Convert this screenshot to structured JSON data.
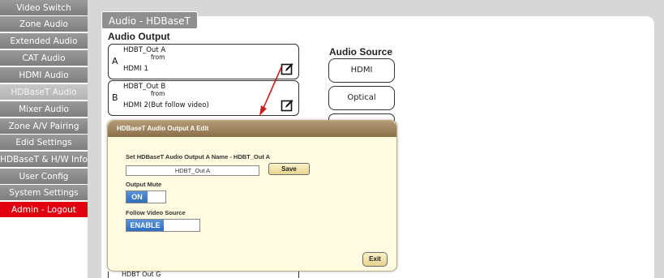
{
  "sidebar": {
    "items": [
      {
        "label": "Video Switch"
      },
      {
        "label": "Zone Audio"
      },
      {
        "label": "Extended Audio"
      },
      {
        "label": "CAT Audio"
      },
      {
        "label": "HDMI Audio"
      },
      {
        "label": "HDBaseT Audio"
      },
      {
        "label": "Mixer Audio"
      },
      {
        "label": "Zone A/V Pairing"
      },
      {
        "label": "Edid Settings"
      },
      {
        "label": "HDBaseT & H/W Info"
      },
      {
        "label": "User Config"
      },
      {
        "label": "System Settings"
      },
      {
        "label": "Admin - Logout"
      }
    ],
    "active_index": 5
  },
  "page": {
    "tab_title": "Audio - HDBaseT",
    "audio_output_title": "Audio Output",
    "audio_source_title": "Audio Source"
  },
  "outputs": [
    {
      "name": "HDBT_Out A",
      "from": "from",
      "letter": "A",
      "source": "HDMI 1"
    },
    {
      "name": "HDBT_Out B",
      "from": "from",
      "letter": "B",
      "source": "HDMI 2(But follow video)"
    }
  ],
  "bottom_partial_output": "HDBT Out G",
  "sources": [
    {
      "label": "HDMI"
    },
    {
      "label": "Optical"
    }
  ],
  "dialog": {
    "title": "HDBaseT Audio Output A Edit",
    "name_label": "Set HDBaseT Audio Output A Name - HDBT_Out A",
    "name_value": "HDBT_Out A",
    "save_label": "Save",
    "mute_label": "Output Mute",
    "mute_state": "ON",
    "follow_label": "Follow Video Source",
    "follow_state": "ENABLE",
    "exit_label": "Exit"
  },
  "colors": {
    "nav_gray": "#8a8a8a",
    "logout_red": "#e0000f",
    "toggle_blue": "#2f6dbd",
    "dialog_bg": "#fffbe0",
    "dialog_title_brown": "#9b7f58",
    "arrow_red": "#c81e1e"
  }
}
